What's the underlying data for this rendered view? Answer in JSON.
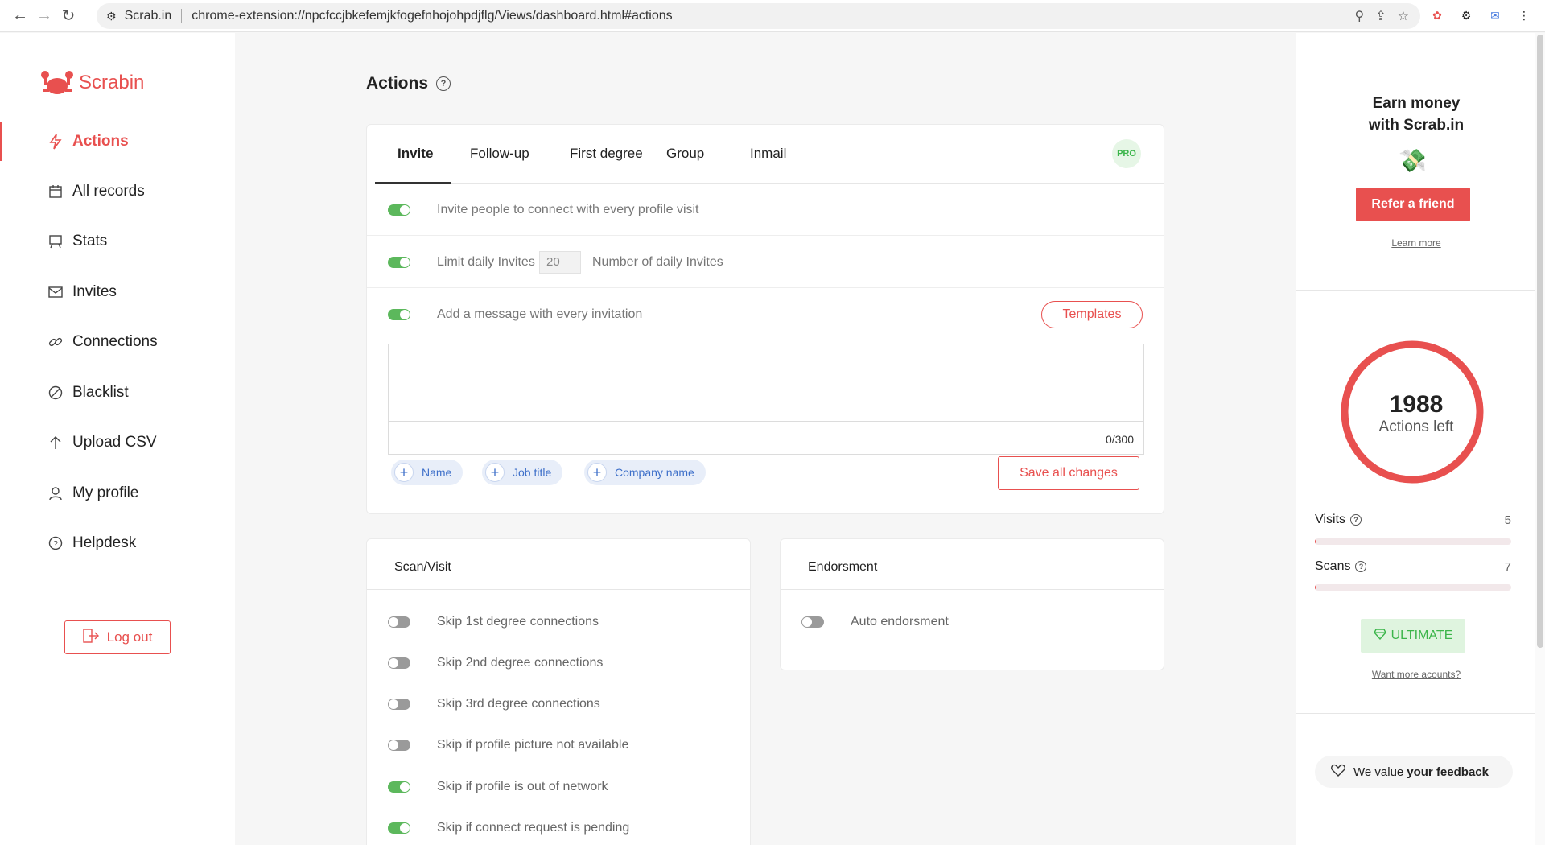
{
  "browser": {
    "site_name": "Scrab.in",
    "url": "chrome-extension://npcfccjbkefemjkfogefnhojohpdjflg/Views/dashboard.html#actions"
  },
  "sidebar": {
    "logo_text": "Scrabin",
    "items": [
      {
        "label": "Actions",
        "icon": "lightning-icon",
        "active": true
      },
      {
        "label": "All records",
        "icon": "calendar-icon"
      },
      {
        "label": "Stats",
        "icon": "chart-icon"
      },
      {
        "label": "Invites",
        "icon": "envelope-icon"
      },
      {
        "label": "Connections",
        "icon": "link-icon"
      },
      {
        "label": "Blacklist",
        "icon": "ban-icon"
      },
      {
        "label": "Upload CSV",
        "icon": "arrow-up-icon"
      },
      {
        "label": "My profile",
        "icon": "user-icon"
      },
      {
        "label": "Helpdesk",
        "icon": "question-icon"
      }
    ],
    "logout_label": "Log out"
  },
  "main": {
    "title": "Actions",
    "tabs": [
      {
        "label": "Invite",
        "active": true
      },
      {
        "label": "Follow-up"
      },
      {
        "label": "First degree"
      },
      {
        "label": "Group"
      },
      {
        "label": "Inmail"
      }
    ],
    "pro_badge": "PRO",
    "invite": {
      "row1_label": "Invite people to connect with every profile visit",
      "row2_label": "Limit daily Invites",
      "daily_limit": "20",
      "row2_suffix": "Number of daily Invites",
      "row3_label": "Add a message with every invitation",
      "templates_label": "Templates",
      "message_value": "",
      "counter": "0/300",
      "chips": [
        "Name",
        "Job title",
        "Company name"
      ],
      "save_label": "Save all changes"
    },
    "scan_visit": {
      "title": "Scan/Visit",
      "options": [
        {
          "label": "Skip 1st degree connections",
          "on": false
        },
        {
          "label": "Skip 2nd degree connections",
          "on": false
        },
        {
          "label": "Skip 3rd degree connections",
          "on": false
        },
        {
          "label": "Skip if profile picture not available",
          "on": false
        },
        {
          "label": "Skip if profile is out of network",
          "on": true
        },
        {
          "label": "Skip if connect request is pending",
          "on": true
        }
      ]
    },
    "endorsment": {
      "title": "Endorsment",
      "options": [
        {
          "label": "Auto endorsment",
          "on": false
        }
      ]
    }
  },
  "right_panel": {
    "earn_line1": "Earn money",
    "earn_line2": "with Scrab.in",
    "refer_label": "Refer a friend",
    "learn_more": "Learn more",
    "actions_left": "1988",
    "actions_left_label": "Actions left",
    "actions_left_fraction": 1.0,
    "visits_label": "Visits",
    "visits_value": "5",
    "visits_fill": 0.005,
    "scans_label": "Scans",
    "scans_value": "7",
    "scans_fill": 0.007,
    "ultimate_label": "ULTIMATE",
    "more_accounts": "Want more acounts?",
    "feedback_prefix": "We value",
    "feedback_link": "your feedback"
  },
  "colors": {
    "brand": "#e8504f",
    "toggle_on": "#5cb85c",
    "toggle_off": "#9a9a9a",
    "chip_text": "#3d6fc9",
    "ultimate_green": "#3bb54a"
  }
}
